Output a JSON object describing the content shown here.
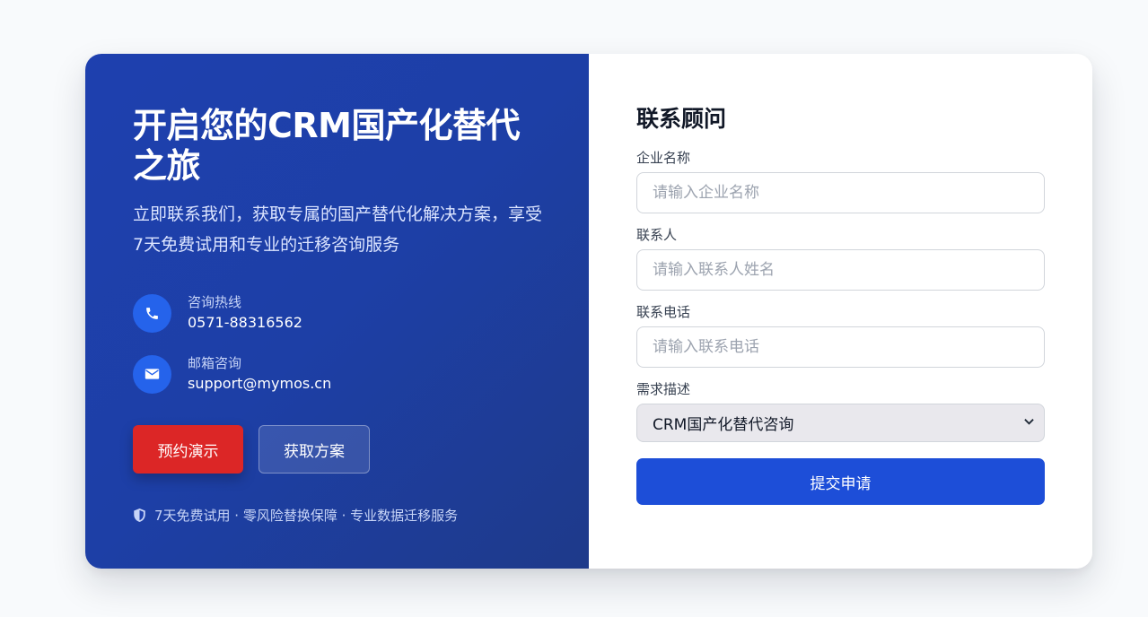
{
  "hero": {
    "title": "开启您的CRM国产化替代之旅",
    "subtitle": "立即联系我们，获取专属的国产替代化解决方案，享受7天免费试用和专业的迁移咨询服务"
  },
  "contacts": [
    {
      "icon": "phone-icon",
      "label": "咨询热线",
      "value": "0571-88316562"
    },
    {
      "icon": "mail-icon",
      "label": "邮箱咨询",
      "value": "support@mymos.cn"
    }
  ],
  "buttons": {
    "demo": "预约演示",
    "plan": "获取方案"
  },
  "guarantee": "7天免费试用 · 零风险替换保障 · 专业数据迁移服务",
  "form": {
    "title": "联系顾问",
    "company": {
      "label": "企业名称",
      "placeholder": "请输入企业名称",
      "value": ""
    },
    "contact": {
      "label": "联系人",
      "placeholder": "请输入联系人姓名",
      "value": ""
    },
    "phone": {
      "label": "联系电话",
      "placeholder": "请输入联系电话",
      "value": ""
    },
    "need": {
      "label": "需求描述",
      "selected": "CRM国产化替代咨询"
    },
    "submit": "提交申请"
  },
  "colors": {
    "hero_bg": "#1e40af",
    "demo_button": "#dc2626",
    "submit_button": "#1d4ed8",
    "icon_circle": "#2563eb"
  }
}
